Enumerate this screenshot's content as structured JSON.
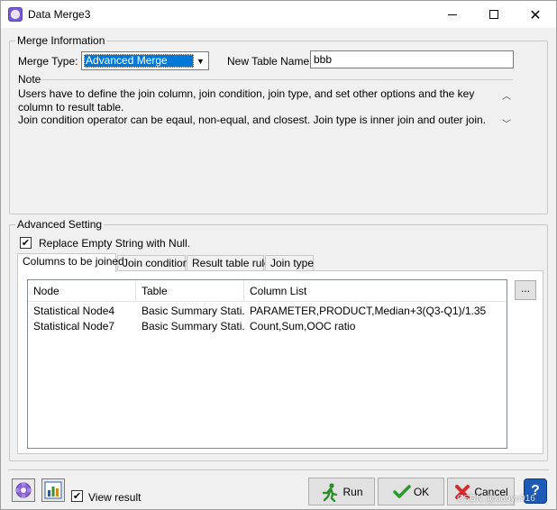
{
  "window": {
    "title": "Data Merge3",
    "icon": "gear-flower-icon"
  },
  "merge_info": {
    "legend": "Merge Information",
    "merge_type_label": "Merge Type:",
    "merge_type_value": "Advanced Merge",
    "table_name_label": "New Table Name:",
    "table_name_value": "bbb",
    "note_label": "Note",
    "note_lines": [
      "Users have to define the join column, join condition, join type, and set other options and the key column to result table.",
      "Join condition operator can be eqaul, non-equal, and closest. Join type is inner join and outer join."
    ]
  },
  "advanced": {
    "legend": "Advanced Setting",
    "replace_label": "Replace Empty String  with Null.",
    "replace_checked": true,
    "tabs": [
      {
        "label": "Columns to be joined",
        "active": true
      },
      {
        "label": "Join condition",
        "active": false
      },
      {
        "label": "Result table rule",
        "active": false
      },
      {
        "label": "Join type",
        "active": false
      }
    ],
    "columns": [
      "Node",
      "Table",
      "Column List"
    ],
    "rows": [
      [
        "Statistical Node4",
        "Basic Summary Stati...",
        "PARAMETER,PRODUCT,Median+3(Q3-Q1)/1.35"
      ],
      [
        "Statistical Node7",
        "Basic Summary Stati...",
        "Count,Sum,OOC ratio"
      ]
    ],
    "ellipsis_label": "..."
  },
  "footer": {
    "view_result_label": "View result",
    "view_result_checked": true,
    "run_label": "Run",
    "ok_label": "OK",
    "cancel_label": "Cancel",
    "help_label": "?",
    "watermark": "CSDN @xiaoyu916"
  }
}
